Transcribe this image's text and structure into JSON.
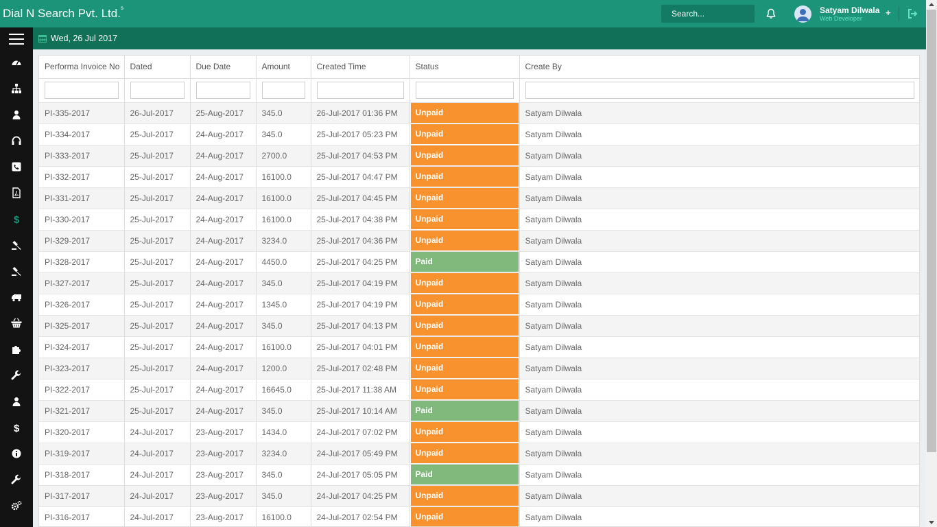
{
  "header": {
    "brand": "Dial N Search Pvt. Ltd.",
    "brand_sup": "s",
    "search_placeholder": "Search...",
    "user_name": "Satyam Dilwala",
    "user_role": "Web Developer",
    "plus_label": "+"
  },
  "datebar": {
    "date": "Wed, 26 Jul 2017"
  },
  "sidebar": {
    "items": [
      {
        "icon": "dashboard-icon"
      },
      {
        "icon": "sitemap-icon"
      },
      {
        "icon": "user-icon"
      },
      {
        "icon": "headphones-icon"
      },
      {
        "icon": "phone-icon"
      },
      {
        "icon": "pdf-file-icon"
      },
      {
        "icon": "dollar-icon"
      },
      {
        "icon": "gavel-icon"
      },
      {
        "icon": "gavel-icon"
      },
      {
        "icon": "truck-icon"
      },
      {
        "icon": "basket-icon"
      },
      {
        "icon": "puzzle-icon"
      },
      {
        "icon": "wrench-icon"
      },
      {
        "icon": "user-icon"
      },
      {
        "icon": "dollar-icon"
      },
      {
        "icon": "info-icon"
      },
      {
        "icon": "wrench-icon"
      },
      {
        "icon": "cogs-icon"
      }
    ]
  },
  "table": {
    "columns": [
      "Performa Invoice No",
      "Dated",
      "Due Date",
      "Amount",
      "Created Time",
      "Status",
      "Create By"
    ],
    "rows": [
      {
        "no": "PI-335-2017",
        "dated": "26-Jul-2017",
        "due": "25-Aug-2017",
        "amount": "345.0",
        "created": "26-Jul-2017 01:36 PM",
        "status": "Unpaid",
        "by": "Satyam Dilwala"
      },
      {
        "no": "PI-334-2017",
        "dated": "25-Jul-2017",
        "due": "24-Aug-2017",
        "amount": "345.0",
        "created": "25-Jul-2017 05:23 PM",
        "status": "Unpaid",
        "by": "Satyam Dilwala"
      },
      {
        "no": "PI-333-2017",
        "dated": "25-Jul-2017",
        "due": "24-Aug-2017",
        "amount": "2700.0",
        "created": "25-Jul-2017 04:53 PM",
        "status": "Unpaid",
        "by": "Satyam Dilwala"
      },
      {
        "no": "PI-332-2017",
        "dated": "25-Jul-2017",
        "due": "24-Aug-2017",
        "amount": "16100.0",
        "created": "25-Jul-2017 04:47 PM",
        "status": "Unpaid",
        "by": "Satyam Dilwala"
      },
      {
        "no": "PI-331-2017",
        "dated": "25-Jul-2017",
        "due": "24-Aug-2017",
        "amount": "16100.0",
        "created": "25-Jul-2017 04:45 PM",
        "status": "Unpaid",
        "by": "Satyam Dilwala"
      },
      {
        "no": "PI-330-2017",
        "dated": "25-Jul-2017",
        "due": "24-Aug-2017",
        "amount": "16100.0",
        "created": "25-Jul-2017 04:38 PM",
        "status": "Unpaid",
        "by": "Satyam Dilwala"
      },
      {
        "no": "PI-329-2017",
        "dated": "25-Jul-2017",
        "due": "24-Aug-2017",
        "amount": "3234.0",
        "created": "25-Jul-2017 04:36 PM",
        "status": "Unpaid",
        "by": "Satyam Dilwala"
      },
      {
        "no": "PI-328-2017",
        "dated": "25-Jul-2017",
        "due": "24-Aug-2017",
        "amount": "4450.0",
        "created": "25-Jul-2017 04:25 PM",
        "status": "Paid",
        "by": "Satyam Dilwala"
      },
      {
        "no": "PI-327-2017",
        "dated": "25-Jul-2017",
        "due": "24-Aug-2017",
        "amount": "345.0",
        "created": "25-Jul-2017 04:19 PM",
        "status": "Unpaid",
        "by": "Satyam Dilwala"
      },
      {
        "no": "PI-326-2017",
        "dated": "25-Jul-2017",
        "due": "24-Aug-2017",
        "amount": "1345.0",
        "created": "25-Jul-2017 04:19 PM",
        "status": "Unpaid",
        "by": "Satyam Dilwala"
      },
      {
        "no": "PI-325-2017",
        "dated": "25-Jul-2017",
        "due": "24-Aug-2017",
        "amount": "345.0",
        "created": "25-Jul-2017 04:13 PM",
        "status": "Unpaid",
        "by": "Satyam Dilwala"
      },
      {
        "no": "PI-324-2017",
        "dated": "25-Jul-2017",
        "due": "24-Aug-2017",
        "amount": "16100.0",
        "created": "25-Jul-2017 04:01 PM",
        "status": "Unpaid",
        "by": "Satyam Dilwala"
      },
      {
        "no": "PI-323-2017",
        "dated": "25-Jul-2017",
        "due": "24-Aug-2017",
        "amount": "1200.0",
        "created": "25-Jul-2017 02:48 PM",
        "status": "Unpaid",
        "by": "Satyam Dilwala"
      },
      {
        "no": "PI-322-2017",
        "dated": "25-Jul-2017",
        "due": "24-Aug-2017",
        "amount": "16645.0",
        "created": "25-Jul-2017 11:38 AM",
        "status": "Unpaid",
        "by": "Satyam Dilwala"
      },
      {
        "no": "PI-321-2017",
        "dated": "25-Jul-2017",
        "due": "24-Aug-2017",
        "amount": "345.0",
        "created": "25-Jul-2017 10:14 AM",
        "status": "Paid",
        "by": "Satyam Dilwala"
      },
      {
        "no": "PI-320-2017",
        "dated": "24-Jul-2017",
        "due": "23-Aug-2017",
        "amount": "1434.0",
        "created": "24-Jul-2017 07:02 PM",
        "status": "Unpaid",
        "by": "Satyam Dilwala"
      },
      {
        "no": "PI-319-2017",
        "dated": "24-Jul-2017",
        "due": "23-Aug-2017",
        "amount": "3234.0",
        "created": "24-Jul-2017 05:49 PM",
        "status": "Unpaid",
        "by": "Satyam Dilwala"
      },
      {
        "no": "PI-318-2017",
        "dated": "24-Jul-2017",
        "due": "23-Aug-2017",
        "amount": "345.0",
        "created": "24-Jul-2017 05:05 PM",
        "status": "Paid",
        "by": "Satyam Dilwala"
      },
      {
        "no": "PI-317-2017",
        "dated": "24-Jul-2017",
        "due": "23-Aug-2017",
        "amount": "345.0",
        "created": "24-Jul-2017 04:25 PM",
        "status": "Unpaid",
        "by": "Satyam Dilwala"
      },
      {
        "no": "PI-316-2017",
        "dated": "24-Jul-2017",
        "due": "23-Aug-2017",
        "amount": "16100.0",
        "created": "24-Jul-2017 02:54 PM",
        "status": "Unpaid",
        "by": "Satyam Dilwala"
      }
    ]
  },
  "colors": {
    "topbar": "#1b9479",
    "datebar": "#117058",
    "sidebar": "#131313",
    "unpaid": "#f7922f",
    "paid": "#80b97b",
    "accent": "#61e0c3"
  }
}
